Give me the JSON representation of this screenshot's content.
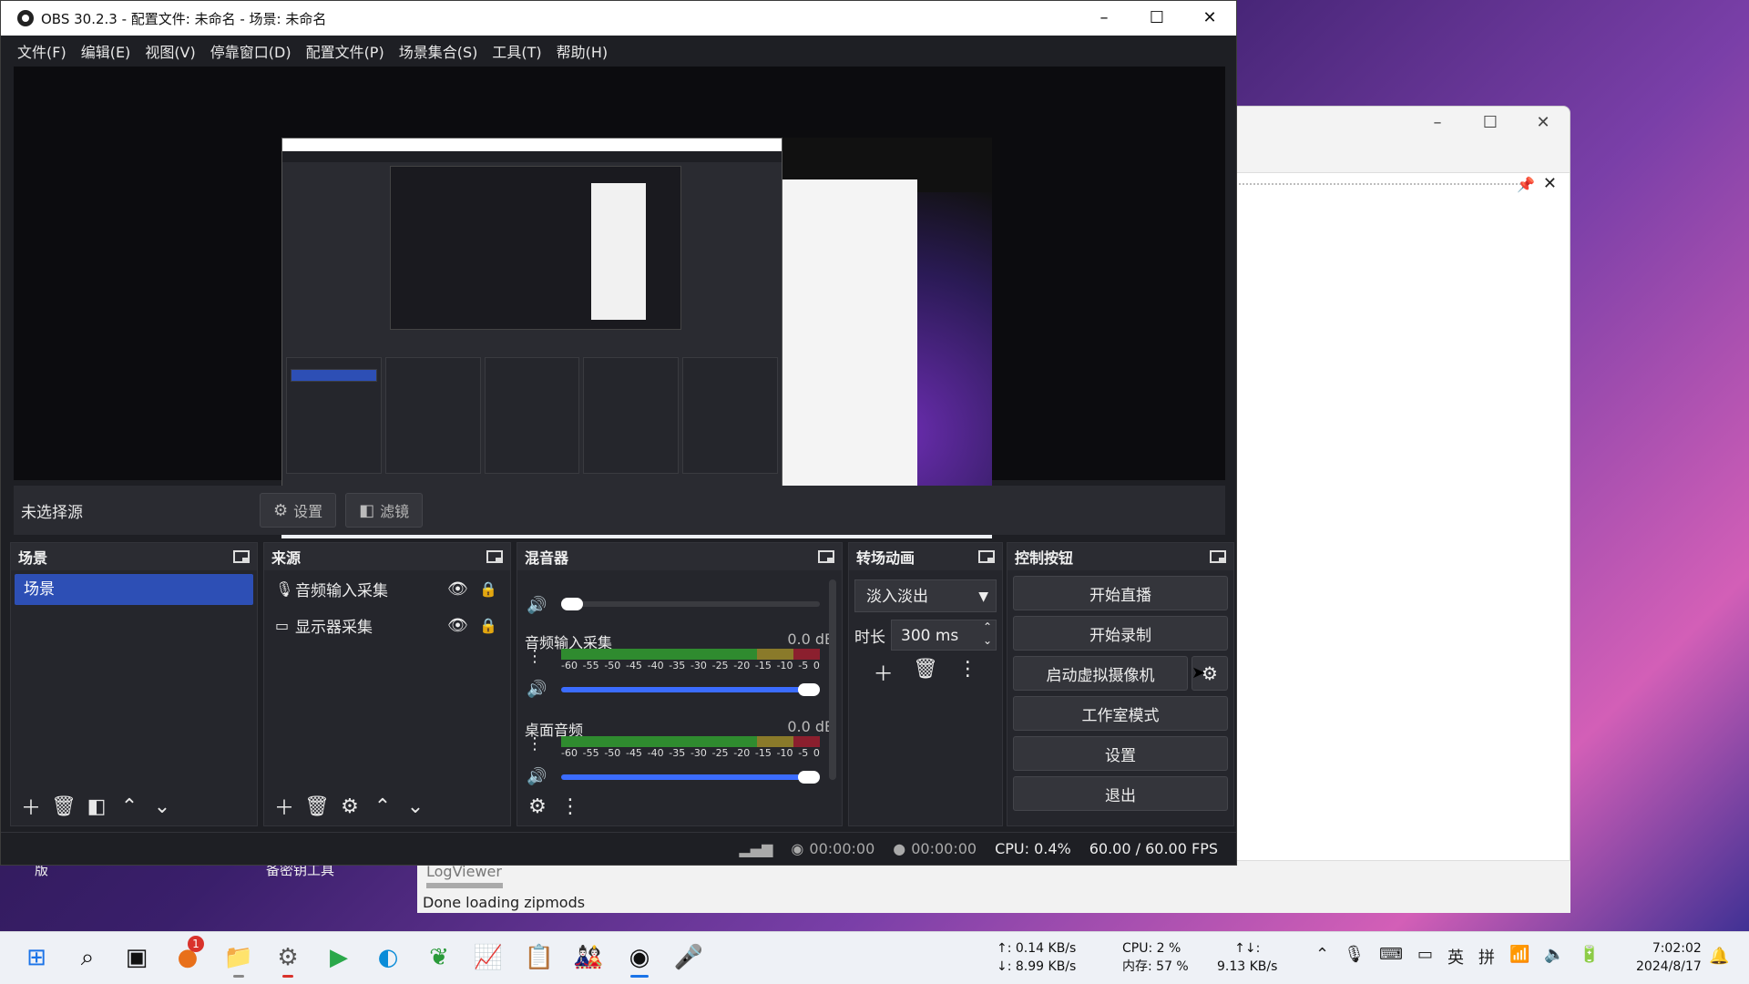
{
  "window": {
    "title": "OBS 30.2.3 - 配置文件: 未命名 - 场景: 未命名"
  },
  "menu": [
    "文件(F)",
    "编辑(E)",
    "视图(V)",
    "停靠窗口(D)",
    "配置文件(P)",
    "场景集合(S)",
    "工具(T)",
    "帮助(H)"
  ],
  "source_bar": {
    "no_source": "未选择源",
    "settings_label": "设置",
    "filters_label": "滤镜"
  },
  "docks": {
    "scenes": {
      "title": "场景",
      "items": [
        "场景"
      ]
    },
    "sources": {
      "title": "来源",
      "items": [
        "音频输入采集",
        "显示器采集"
      ]
    },
    "mixer": {
      "title": "混音器",
      "channels": [
        {
          "name": "音频输入采集",
          "db": "0.0 dB"
        },
        {
          "name": "桌面音频",
          "db": "0.0 dB"
        }
      ],
      "scale": [
        "-60",
        "-55",
        "-50",
        "-45",
        "-40",
        "-35",
        "-30",
        "-25",
        "-20",
        "-15",
        "-10",
        "-5",
        "0"
      ]
    },
    "transitions": {
      "title": "转场动画",
      "selected": "淡入淡出",
      "duration_label": "时长",
      "duration_value": "300 ms"
    },
    "controls": {
      "title": "控制按钮",
      "start_stream": "开始直播",
      "start_record": "开始录制",
      "virtual_cam": "启动虚拟摄像机",
      "studio_mode": "工作室模式",
      "settings": "设置",
      "exit": "退出"
    }
  },
  "status": {
    "stream_time": "00:00:00",
    "record_time": "00:00:00",
    "cpu": "CPU: 0.4%",
    "fps": "60.00 / 60.00 FPS"
  },
  "background": {
    "logviewer_title": "LogViewer",
    "logviewer_message": "Done loading zipmods",
    "desk_label_1": "版",
    "desk_label_2": "备密钥工具"
  },
  "taskbar": {
    "notification_count": "1",
    "net_up": "↑: 0.14 KB/s",
    "net_down": "↓: 8.99 KB/s",
    "cpu": "CPU: 2 %",
    "mem": "内存: 57 %",
    "total_label": "↑↓:",
    "total_value": "9.13 KB/s",
    "ime_lang": "英",
    "ime_mode": "拼",
    "time": "7:02:02",
    "date": "2024/8/17"
  }
}
